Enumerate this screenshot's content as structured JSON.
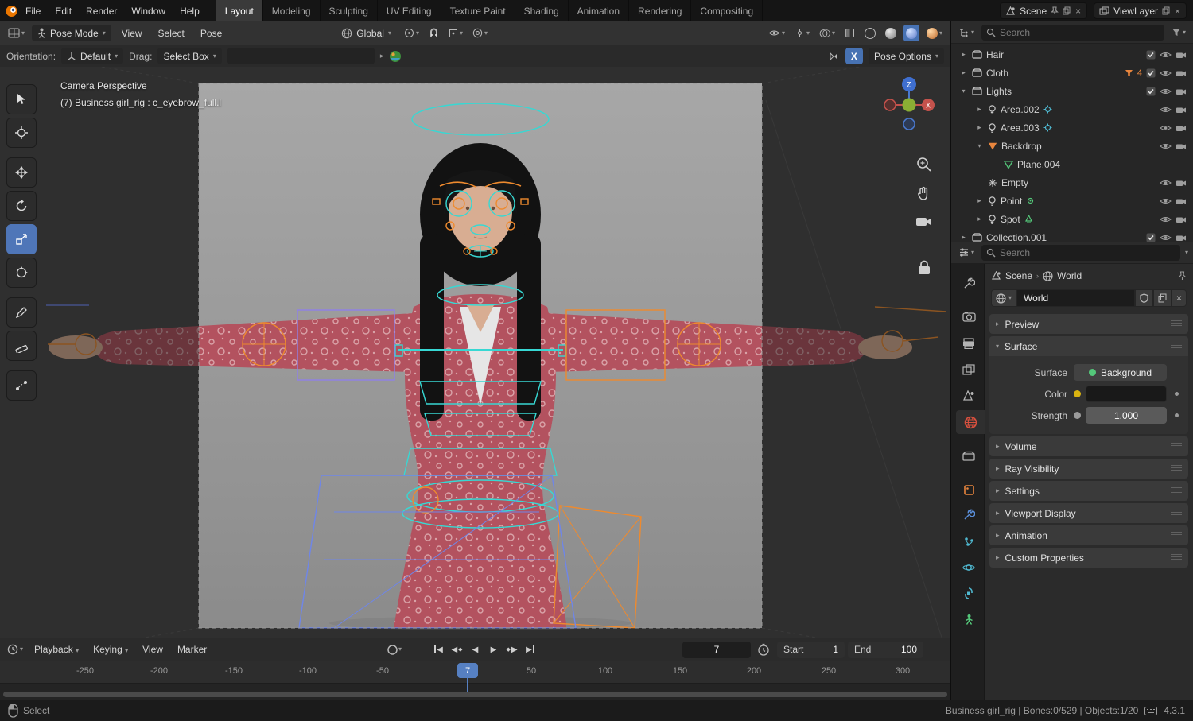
{
  "icons": {
    "chevron_down": "▾",
    "chevron_right": "▸",
    "play": "▶",
    "play_back": "◀",
    "diamond": "◆",
    "close": "×",
    "breadcrumb_sep": "›",
    "check": "✓"
  },
  "colors": {
    "accent": "#4772b3",
    "object_orange": "#e8853d",
    "rig_cyan": "#37d8d3",
    "rig_blue": "#6f86e8",
    "world_red": "#d8503e"
  },
  "topbar": {
    "menus": [
      "File",
      "Edit",
      "Render",
      "Window",
      "Help"
    ],
    "workspaces": [
      "Layout",
      "Modeling",
      "Sculpting",
      "UV Editing",
      "Texture Paint",
      "Shading",
      "Animation",
      "Rendering",
      "Compositing"
    ],
    "scene_label": "Scene",
    "viewlayer_label": "ViewLayer"
  },
  "viewport_header": {
    "mode_value": "Pose Mode",
    "menu_view": "View",
    "menu_select": "Select",
    "menu_pose": "Pose",
    "orientation_value": "Global"
  },
  "tool_settings": {
    "orientation_label": "Orientation:",
    "orientation_value": "Default",
    "drag_label": "Drag:",
    "drag_value": "Select Box",
    "mirror_x_label": "X",
    "pose_options_label": "Pose Options"
  },
  "viewport": {
    "overlay_line1": "Camera Perspective",
    "overlay_line2": "(7) Business girl_rig : c_eyebrow_full.l",
    "gizmo_z": "Z",
    "gizmo_x": "X"
  },
  "outliner": {
    "search_placeholder": "Search",
    "rows": [
      {
        "label": "Hair"
      },
      {
        "label": "Cloth",
        "badge": "4"
      },
      {
        "label": "Lights"
      },
      {
        "label": "Area.002"
      },
      {
        "label": "Area.003"
      },
      {
        "label": "Backdrop"
      },
      {
        "label": "Plane.004"
      },
      {
        "label": "Empty"
      },
      {
        "label": "Point"
      },
      {
        "label": "Spot"
      },
      {
        "label": "Collection.001"
      }
    ]
  },
  "properties": {
    "search_placeholder": "Search",
    "breadcrumb_scene": "Scene",
    "breadcrumb_world": "World",
    "datablock_name": "World",
    "panel_preview": "Preview",
    "panel_surface": "Surface",
    "surface_label": "Surface",
    "surface_value": "Background",
    "color_label": "Color",
    "strength_label": "Strength",
    "strength_value": "1.000",
    "panel_volume": "Volume",
    "panel_ray": "Ray Visibility",
    "panel_settings": "Settings",
    "panel_viewport_display": "Viewport Display",
    "panel_animation": "Animation",
    "panel_custom": "Custom Properties"
  },
  "timeline": {
    "menu_playback": "Playback",
    "menu_keying": "Keying",
    "menu_view": "View",
    "menu_marker": "Marker",
    "current_frame": "7",
    "start_label": "Start",
    "start_value": "1",
    "end_label": "End",
    "end_value": "100",
    "ticks": [
      "-250",
      "-200",
      "-150",
      "-100",
      "-50",
      "50",
      "100",
      "150",
      "200",
      "250",
      "300"
    ]
  },
  "statusbar": {
    "left_label": "Select",
    "info": "Business girl_rig | Bones:0/529 | Objects:1/20",
    "version": "4.3.1"
  }
}
